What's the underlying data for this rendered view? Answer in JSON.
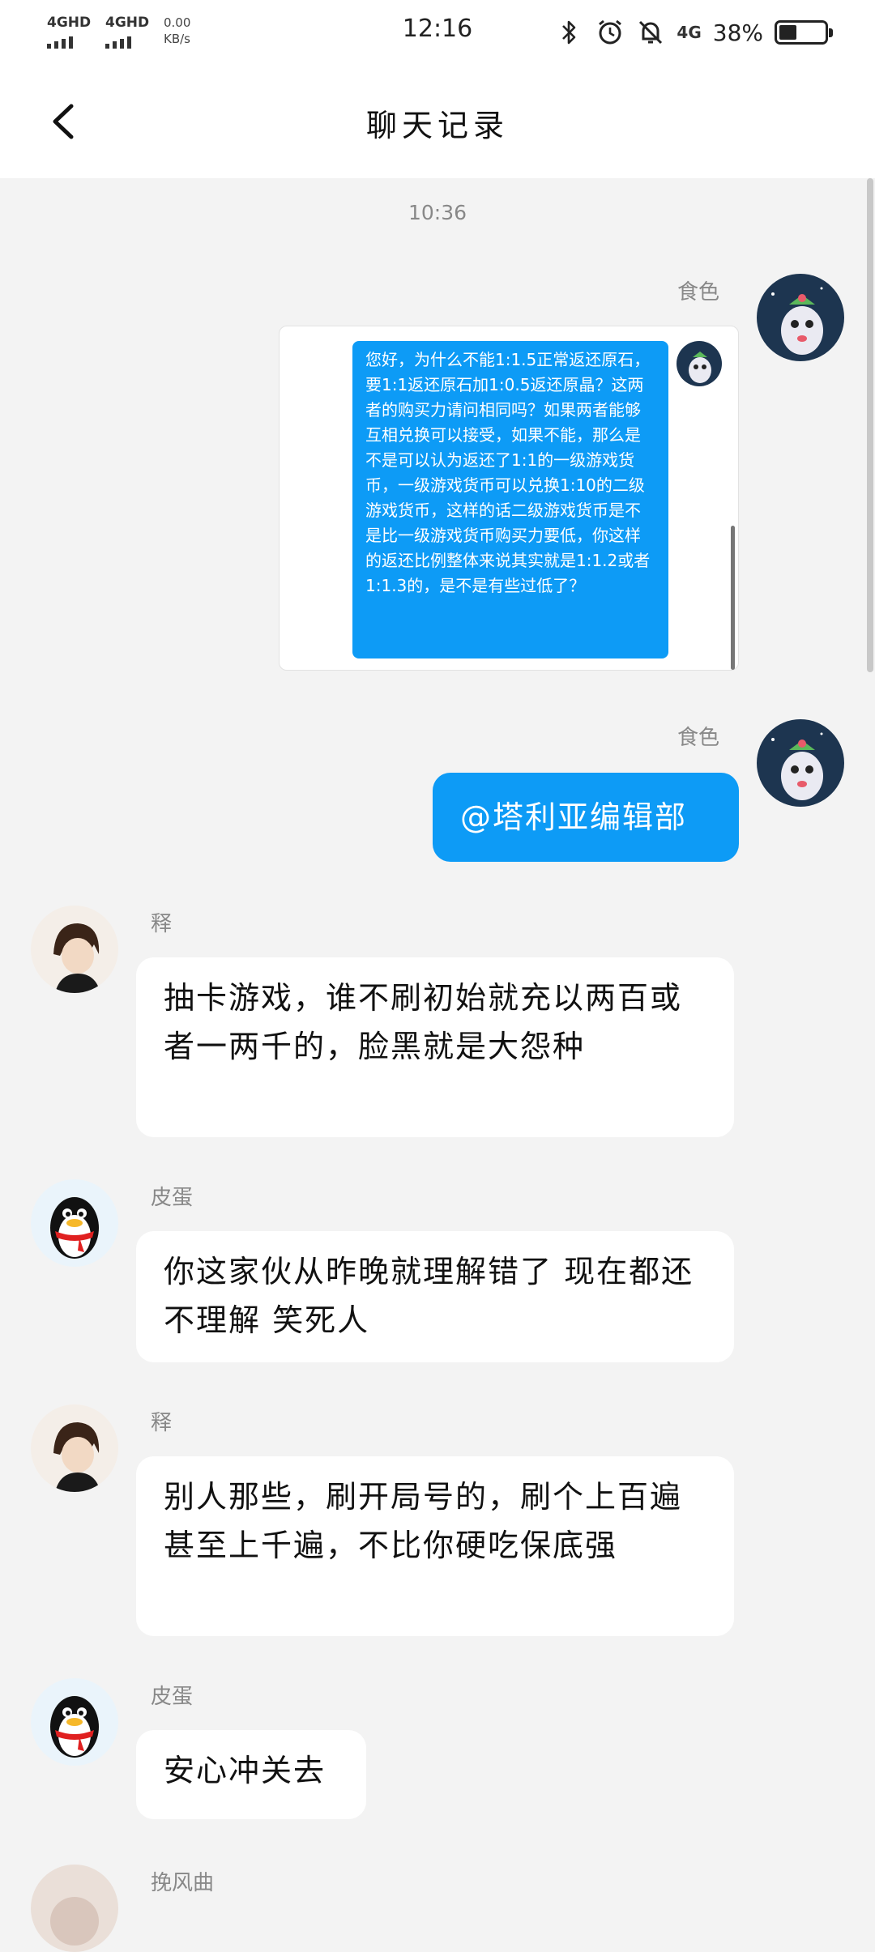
{
  "status_bar": {
    "network_1": "4GHD",
    "network_2": "4GHD",
    "speed_value": "0.00",
    "speed_unit": "KB/s",
    "time": "12:16",
    "net_4g": "4G",
    "battery_text": "38%",
    "battery_level": 0.38
  },
  "header": {
    "title": "聊天记录"
  },
  "chat": {
    "timestamp": "10:36",
    "messages": [
      {
        "sender": "食色",
        "side": "right",
        "type": "screenshot",
        "quoted_text": "您好，为什么不能1:1.5正常返还原石，要1:1返还原石加1:0.5返还原晶？这两者的购买力请问相同吗？如果两者能够互相兑换可以接受，如果不能，那么是不是可以认为返还了1:1的一级游戏货币，一级游戏货币可以兑换1:10的二级游戏货币，这样的话二级游戏货币是不是比一级游戏货币购买力要低，你这样的返还比例整体来说其实就是1:1.2或者1:1.3的，是不是有些过低了？"
      },
      {
        "sender": "食色",
        "side": "right",
        "text": "@塔利亚编辑部"
      },
      {
        "sender": "释",
        "side": "left",
        "text": "抽卡游戏，谁不刷初始就充以两百或者一两千的，脸黑就是大怨种"
      },
      {
        "sender": "皮蛋",
        "side": "left",
        "text": "你这家伙从昨晚就理解错了  现在都还不理解 笑死人"
      },
      {
        "sender": "释",
        "side": "left",
        "text": "别人那些，刷开局号的，刷个上百遍甚至上千遍，不比你硬吃保底强"
      },
      {
        "sender": "皮蛋",
        "side": "left",
        "text": "安心冲关去"
      },
      {
        "sender": "挽风曲",
        "side": "left",
        "text": ""
      }
    ]
  },
  "colors": {
    "outgoing_bubble": "#0d9bf6",
    "incoming_bubble": "#ffffff",
    "background": "#f3f3f3"
  },
  "icons": [
    "back-arrow-icon",
    "bluetooth-icon",
    "alarm-icon",
    "mute-bell-icon",
    "battery-icon"
  ]
}
